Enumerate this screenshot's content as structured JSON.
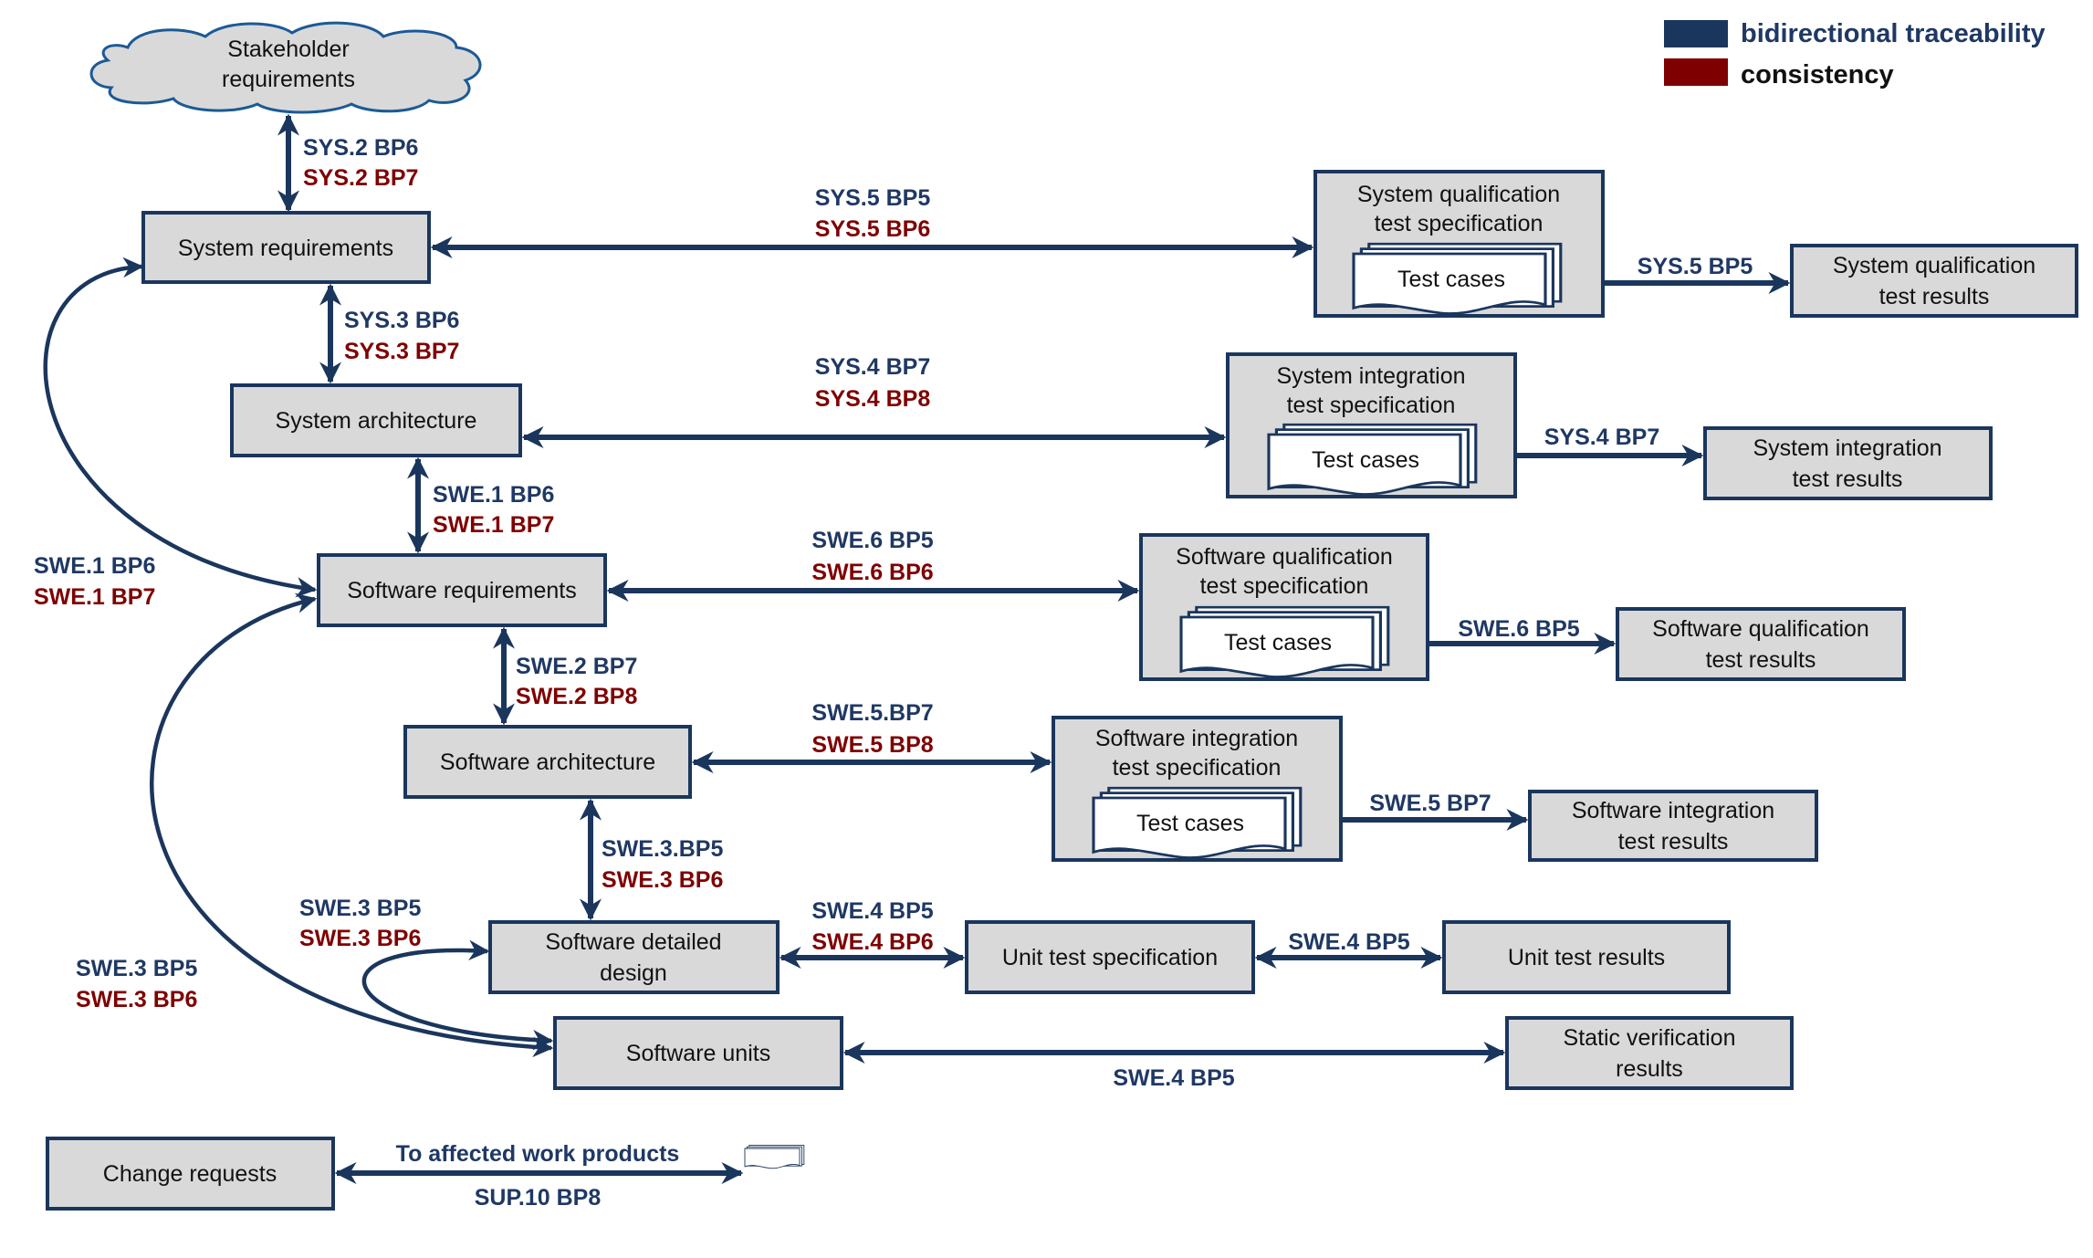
{
  "legend": {
    "items": [
      {
        "label": "bidirectional traceability",
        "color": "#1b365d"
      },
      {
        "label": "consistency",
        "color": "#7f0000"
      }
    ]
  },
  "colors": {
    "traceability": "#1f3864",
    "consistency": "#7f0000",
    "box_fill": "#d9d9d9",
    "border": "#1b365d"
  },
  "nodes": {
    "stakeholder": [
      "Stakeholder",
      "requirements"
    ],
    "sys_req": [
      "System requirements"
    ],
    "sys_arch": [
      "System architecture"
    ],
    "sw_req": [
      "Software requirements"
    ],
    "sw_arch": [
      "Software architecture"
    ],
    "sw_dd": [
      "Software detailed",
      "design"
    ],
    "sw_units": [
      "Software units"
    ],
    "change_req": [
      "Change requests"
    ],
    "sysqual_spec": [
      "System qualification",
      "test specification"
    ],
    "sysqual_res": [
      "System qualification",
      "test results"
    ],
    "sysint_spec": [
      "System integration",
      "test specification"
    ],
    "sysint_res": [
      "System integration",
      "test results"
    ],
    "swqual_spec": [
      "Software qualification",
      "test specification"
    ],
    "swqual_res": [
      "Software qualification",
      "test results"
    ],
    "swint_spec": [
      "Software integration",
      "test specification"
    ],
    "swint_res": [
      "Software integration",
      "test results"
    ],
    "unit_spec": [
      "Unit test specification"
    ],
    "unit_res": [
      "Unit test results"
    ],
    "static_res": [
      "Static verification",
      "results"
    ],
    "test_cases": "Test cases"
  },
  "edges": {
    "stake_sysreq": {
      "trace": "SYS.2 BP6",
      "consistency": "SYS.2 BP7"
    },
    "sysreq_sysarch": {
      "trace": "SYS.3 BP6",
      "consistency": "SYS.3 BP7"
    },
    "sysarch_swreq": {
      "trace": "SWE.1 BP6",
      "consistency": "SWE.1 BP7"
    },
    "sysreq_swreq_curve": {
      "trace": "SWE.1 BP6",
      "consistency": "SWE.1 BP7"
    },
    "swreq_swarch": {
      "trace": "SWE.2 BP7",
      "consistency": "SWE.2 BP8"
    },
    "swarch_swdd": {
      "trace": "SWE.3.BP5",
      "consistency": "SWE.3 BP6"
    },
    "swdd_units_curve": {
      "trace": "SWE.3 BP5",
      "consistency": "SWE.3 BP6"
    },
    "swreq_units_curve": {
      "trace": "SWE.3 BP5",
      "consistency": "SWE.3 BP6"
    },
    "sysreq_sysqual": {
      "trace": "SYS.5 BP5",
      "consistency": "SYS.5 BP6"
    },
    "sysqual_results": {
      "trace": "SYS.5 BP5"
    },
    "sysarch_sysint": {
      "trace": "SYS.4 BP7",
      "consistency": "SYS.4 BP8"
    },
    "sysint_results": {
      "trace": "SYS.4 BP7"
    },
    "swreq_swqual": {
      "trace": "SWE.6 BP5",
      "consistency": "SWE.6 BP6"
    },
    "swqual_results": {
      "trace": "SWE.6 BP5"
    },
    "swarch_swint": {
      "trace": "SWE.5.BP7",
      "consistency": "SWE.5 BP8"
    },
    "swint_results": {
      "trace": "SWE.5 BP7"
    },
    "swdd_unitspec": {
      "trace": "SWE.4 BP5",
      "consistency": "SWE.4 BP6"
    },
    "unitspec_results": {
      "trace": "SWE.4 BP5"
    },
    "units_static": {
      "trace": "SWE.4 BP5"
    },
    "change": {
      "top": "To affected work products",
      "bottom": "SUP.10 BP8"
    }
  }
}
